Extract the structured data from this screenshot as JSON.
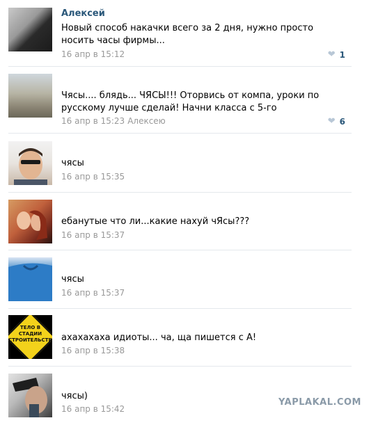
{
  "comments": [
    {
      "author": "Алексей",
      "text": "Новый способ накачки всего за 2 дня, нужно просто носить часы фирмы...",
      "time": "16 апр в 15:12",
      "reply_to": "",
      "likes": "1"
    },
    {
      "author": "",
      "text": "Чясы.... блядь... ЧЯСЫ!!! Оторвись от компа, уроки по русскому лучше сделай! Начни класса с 5-го",
      "time": "16 апр в 15:23",
      "reply_to": "Алексею",
      "likes": "6"
    },
    {
      "author": "",
      "text": "чясы",
      "time": "16 апр в 15:35",
      "reply_to": "",
      "likes": ""
    },
    {
      "author": "",
      "text": "ебанутые что ли...какие нахуй чЯсы???",
      "time": "16 апр в 15:37",
      "reply_to": "",
      "likes": ""
    },
    {
      "author": "",
      "text": "чясы",
      "time": "16 апр в 15:37",
      "reply_to": "",
      "likes": ""
    },
    {
      "author": "",
      "text": "ахахахаха идиоты... ча, ща пишется с А!",
      "time": "16 апр в 15:38",
      "reply_to": "",
      "likes": ""
    },
    {
      "author": "",
      "text": "чясы)",
      "time": "16 апр в 15:42",
      "reply_to": "",
      "likes": ""
    }
  ],
  "sign_text": "ТЕЛО В СТАДИИ СТРОИТЕЛЬСТВА",
  "watermark": "YAPLAKAL.COM",
  "colors": {
    "author": "#2b587a",
    "meta": "#999999",
    "heart": "#b8c7d6",
    "divider": "#e4e8ec"
  }
}
